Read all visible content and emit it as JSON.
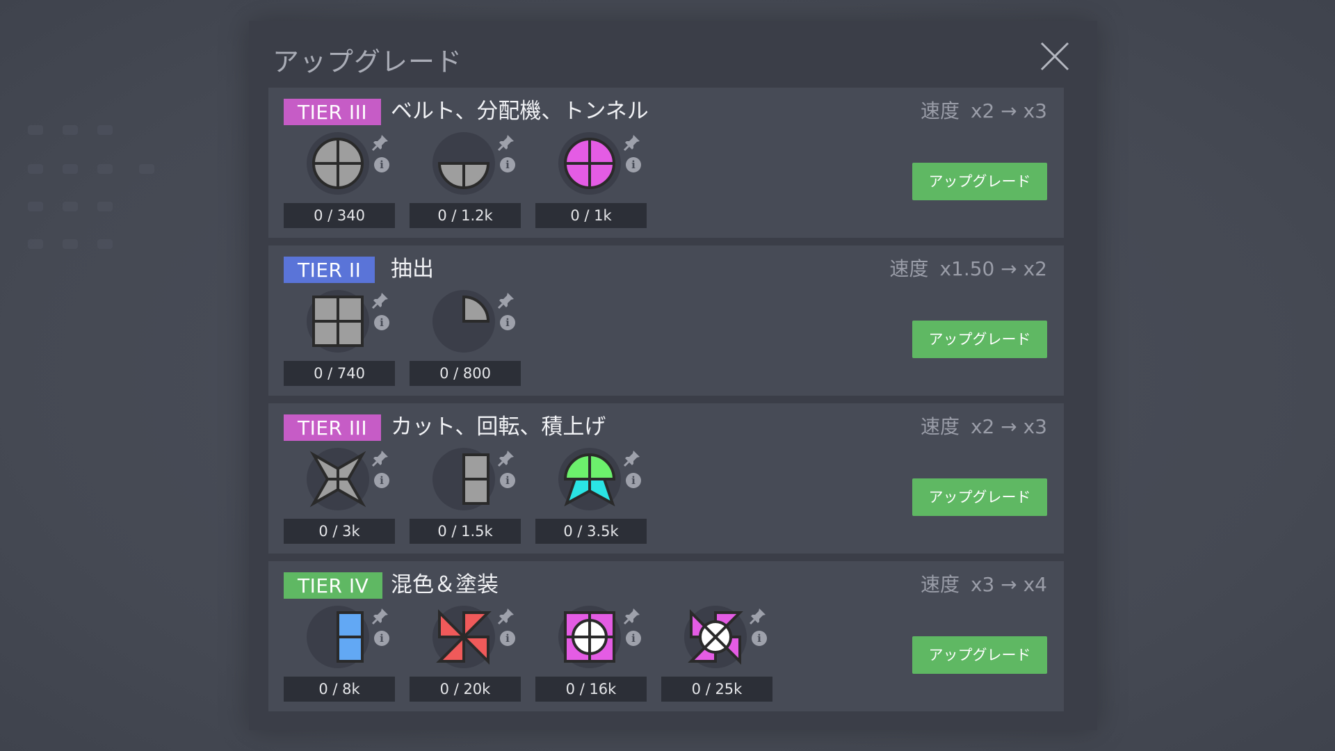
{
  "modal": {
    "title": "アップグレード"
  },
  "tiers": [
    {
      "badge": "TIER III",
      "badge_color": "#c65cc6",
      "name": "ベルト、分配機、トンネル",
      "speed_label": "速度",
      "speed_value": "x2 → x3",
      "button_label": "アップグレード",
      "requirements": [
        {
          "shape": "grey-full-circle",
          "count": "0 / 340"
        },
        {
          "shape": "grey-half-circle",
          "count": "0 / 1.2k"
        },
        {
          "shape": "purple-full-circle",
          "count": "0 / 1k"
        }
      ]
    },
    {
      "badge": "TIER II",
      "badge_color": "#5a74d8",
      "name": "抽出",
      "speed_label": "速度",
      "speed_value": "x1.50 → x2",
      "button_label": "アップグレード",
      "requirements": [
        {
          "shape": "grey-square",
          "count": "0 / 740"
        },
        {
          "shape": "grey-quarter-circle",
          "count": "0 / 800"
        }
      ]
    },
    {
      "badge": "TIER III",
      "badge_color": "#c65cc6",
      "name": "カット、回転、積上げ",
      "speed_label": "速度",
      "speed_value": "x2 → x3",
      "button_label": "アップグレード",
      "requirements": [
        {
          "shape": "grey-star",
          "count": "0 / 3k"
        },
        {
          "shape": "grey-half-rectangle",
          "count": "0 / 1.5k"
        },
        {
          "shape": "green-cyan-stack",
          "count": "0 / 3.5k"
        }
      ]
    },
    {
      "badge": "TIER IV",
      "badge_color": "#5fb863",
      "name": "混色＆塗装",
      "speed_label": "速度",
      "speed_value": "x3 → x4",
      "button_label": "アップグレード",
      "requirements": [
        {
          "shape": "blue-half-rectangle",
          "count": "0 / 8k"
        },
        {
          "shape": "red-windmill",
          "count": "0 / 20k"
        },
        {
          "shape": "purple-square-white-circle",
          "count": "0 / 16k"
        },
        {
          "shape": "purple-star-white-circle",
          "count": "0 / 25k"
        }
      ]
    }
  ],
  "colors": {
    "grey": "#9e9e9e",
    "purple": "#e45ce4",
    "green": "#6cf06c",
    "cyan": "#2ae4e4",
    "blue": "#62a8f4",
    "red": "#f05a5a",
    "white": "#ffffff"
  }
}
